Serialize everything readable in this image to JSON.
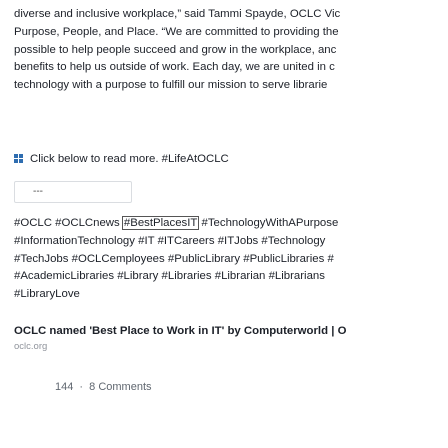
{
  "post": {
    "lines": [
      "diverse and inclusive workplace,” said Tammi Spayde, OCLC Vic",
      "Purpose, People, and Place. “We are committed to providing the",
      "possible to help people succeed and grow in the workplace, anc",
      "benefits to help us outside of work. Each day, we are united in c",
      "technology with a purpose to fulfill our mission to serve librarie"
    ],
    "cta_text": "Click below to read more. #LifeAtOCLC",
    "embed_placeholder": "---",
    "tag_lines": [
      [
        "#OCLC",
        "#OCLCnews",
        "#BestPlacesIT",
        "#TechnologyWithAPurpose"
      ],
      [
        "#InformationTechnology",
        "#IT",
        "#ITCareers",
        "#ITJobs",
        "#Technology"
      ],
      [
        "#TechJobs",
        "#OCLCemployees",
        "#PublicLibrary",
        "#PublicLibraries",
        "#"
      ],
      [
        "#AcademicLibraries",
        "#Library",
        "#Libraries",
        "#Librarian",
        "#Librarians"
      ],
      [
        "#LibraryLove"
      ]
    ]
  },
  "link": {
    "title": "OCLC named 'Best Place to Work in IT' by Computerworld | O",
    "domain": "oclc.org"
  },
  "stats": {
    "reactions": "144",
    "separator": "·",
    "comments": "8 Comments"
  },
  "colors": {
    "text": "#1d2129",
    "muted": "#606770",
    "accent": "#2e6db0"
  }
}
